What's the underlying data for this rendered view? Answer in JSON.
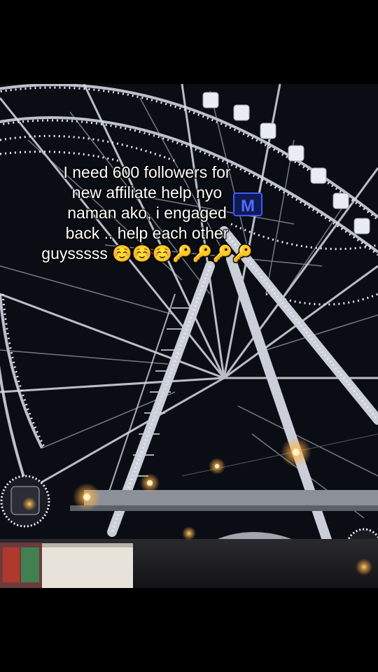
{
  "caption": {
    "text": "I need 600 followers for\nnew affiliate help nyo\nnaman ako, i engaged\nback .. help each other\nguysssss ☺️☺️☺️🔑🔑🔑🔑"
  },
  "scene": {
    "sign_text": "M",
    "colors": {
      "sky": "#0b0d14",
      "structure": "#d8dde6",
      "led": "#f2f4ff",
      "lamp": "#ffb347",
      "sign": "#3b5bff"
    }
  }
}
